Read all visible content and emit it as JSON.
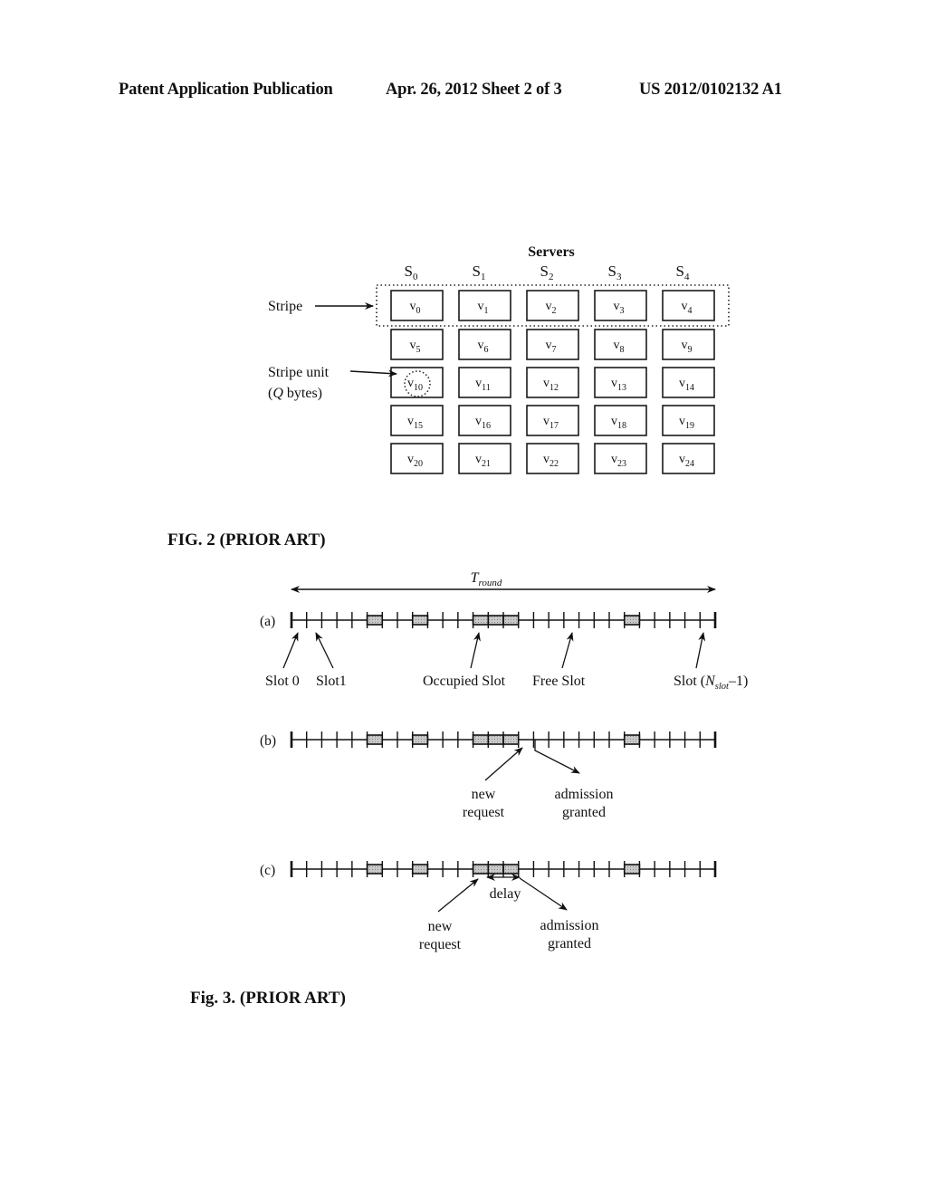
{
  "header": {
    "publication": "Patent Application Publication",
    "date_sheet": "Apr. 26, 2012  Sheet 2 of 3",
    "number": "US 2012/0102132 A1"
  },
  "fig2": {
    "caption": "FIG. 2 (PRIOR ART)",
    "servers_title": "Servers",
    "servers": [
      {
        "base": "S",
        "sub": "0"
      },
      {
        "base": "S",
        "sub": "1"
      },
      {
        "base": "S",
        "sub": "2"
      },
      {
        "base": "S",
        "sub": "3"
      },
      {
        "base": "S",
        "sub": "4"
      }
    ],
    "rows": [
      [
        "0",
        "1",
        "2",
        "3",
        "4"
      ],
      [
        "5",
        "6",
        "7",
        "8",
        "9"
      ],
      [
        "10",
        "11",
        "12",
        "13",
        "14"
      ],
      [
        "15",
        "16",
        "17",
        "18",
        "19"
      ],
      [
        "20",
        "21",
        "22",
        "23",
        "24"
      ]
    ],
    "unit_prefix": "v",
    "stripe_label": "Stripe",
    "stripe_unit_label": "Stripe unit",
    "stripe_unit_size_open": "(",
    "stripe_unit_size_var": "Q",
    "stripe_unit_size_rest": " bytes)",
    "highlighted_stripe_row": 0,
    "highlighted_unit": "10"
  },
  "fig3": {
    "caption": "Fig. 3. (PRIOR ART)",
    "round_label_base": "T",
    "round_label_sub": "round",
    "slot_count": 28,
    "occupied_slots": [
      5,
      8,
      12,
      13,
      14,
      22
    ],
    "timelines": [
      {
        "id": "a",
        "label": "(a)"
      },
      {
        "id": "b",
        "label": "(b)"
      },
      {
        "id": "c",
        "label": "(c)"
      }
    ],
    "a_annotations": {
      "slot0": "Slot 0",
      "slot1": "Slot1",
      "occupied": "Occupied Slot",
      "free": "Free Slot",
      "last_prefix": "Slot (",
      "last_var": "N",
      "last_sub": "slot",
      "last_suffix": "–1)"
    },
    "b_annotations": {
      "new_request_1": "new",
      "new_request_2": "request",
      "granted_1": "admission",
      "granted_2": "granted"
    },
    "c_annotations": {
      "delay": "delay",
      "new_request_1": "new",
      "new_request_2": "request",
      "granted_1": "admission",
      "granted_2": "granted"
    }
  }
}
